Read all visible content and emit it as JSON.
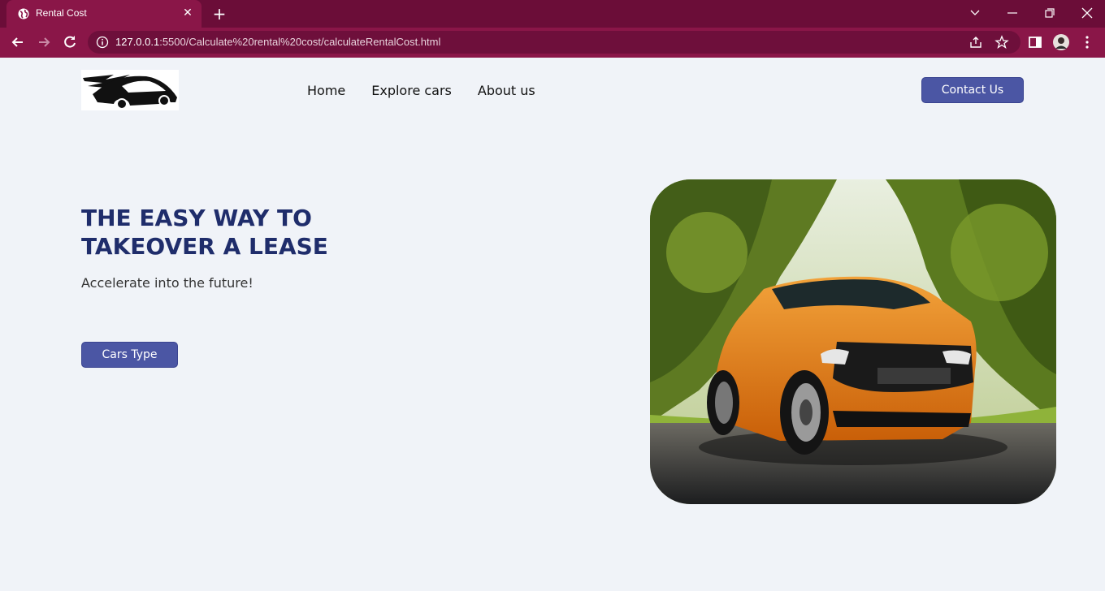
{
  "browser": {
    "tab_title": "Rental Cost",
    "url_host": "127.0.0.1",
    "url_rest": ":5500/Calculate%20rental%20cost/calculateRentalCost.html"
  },
  "header": {
    "nav": [
      "Home",
      "Explore cars",
      "About us"
    ],
    "contact_label": "Contact Us"
  },
  "hero": {
    "title": "THE EASY WAY TO TAKEOVER A LEASE",
    "subtitle": "Accelerate into the future!",
    "button_label": "Cars Type"
  },
  "colors": {
    "accent": "#4b56a4",
    "title": "#1f2d6b",
    "chrome": "#8a1648"
  }
}
